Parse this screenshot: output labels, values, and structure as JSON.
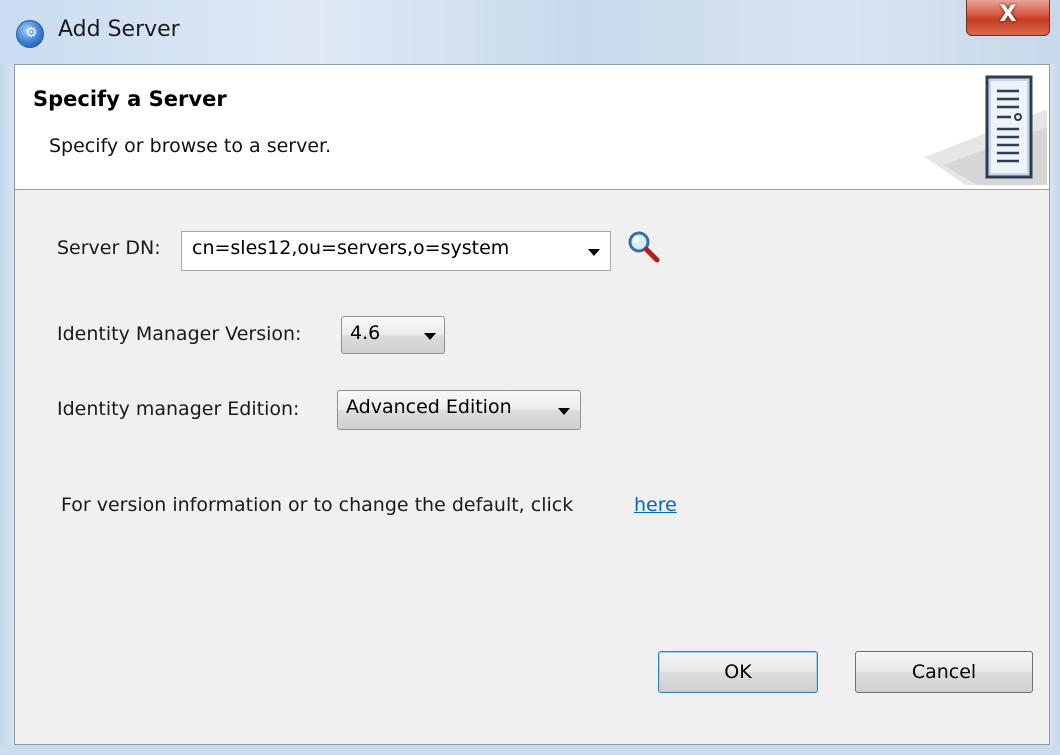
{
  "window": {
    "title": "Add Server",
    "close_label": "X"
  },
  "header": {
    "title": "Specify a Server",
    "description": "Specify or browse to a server."
  },
  "form": {
    "server_dn": {
      "label": "Server DN:",
      "value": "cn=sles12,ou=servers,o=system"
    },
    "version": {
      "label": "Identity Manager Version:",
      "value": "4.6"
    },
    "edition": {
      "label": "Identity manager Edition:",
      "value": "Advanced Edition"
    }
  },
  "info": {
    "text": "For version information or to change the default, click",
    "link": "here"
  },
  "buttons": {
    "ok": "OK",
    "cancel": "Cancel"
  },
  "icons": {
    "app": "globe-icon",
    "browse": "magnifier-icon",
    "wizard": "server-icon"
  },
  "colors": {
    "link": "#0066cc",
    "close_button": "#c63b23",
    "default_button_border": "#3c7fb1"
  }
}
